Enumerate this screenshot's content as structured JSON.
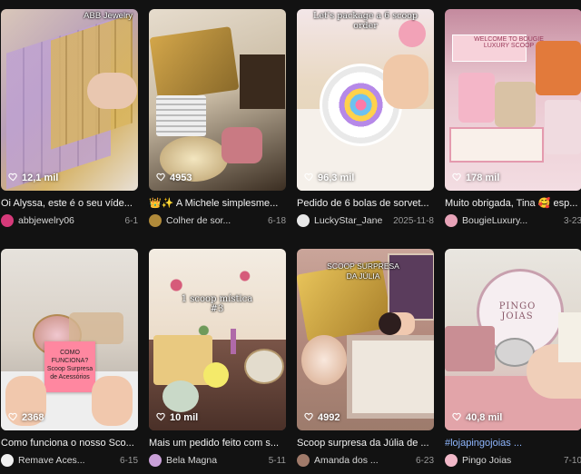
{
  "heart_icon": "heart-outline-icon",
  "cards": [
    {
      "overlay": "ABB Jewelry",
      "views": "12,1 mil",
      "caption": "Oi Alyssa, este é o seu víde...",
      "author": "abbjewelry06",
      "date": "6-1",
      "avatar_color": "#d63a7a"
    },
    {
      "overlay": "",
      "views": "4953",
      "caption": "👑✨ A Michele simplesme...",
      "author": "Colher de sor...",
      "date": "6-18",
      "avatar_color": "#b08a3a"
    },
    {
      "overlay": "Let's package a 6 scoop order",
      "views": "96,3 mil",
      "caption": "Pedido de 6 bolas de sorvet...",
      "author": "LuckyStar_Jane",
      "date": "2025-11-8",
      "avatar_color": "#e8e8e8"
    },
    {
      "overlay": "WELCOME TO BOUGIE LUXURY SCOOP",
      "views": "178 mil",
      "caption": "Muito obrigada, Tina 🥰 esp...",
      "author": "BougieLuxury...",
      "date": "3-23",
      "avatar_color": "#e7a3b8"
    },
    {
      "overlay": "COMO FUNCIONA? Scoop Surpresa de Acessórios",
      "views": "2368",
      "caption": "Como funciona o nosso Sco...",
      "author": "Remave Aces...",
      "date": "6-15",
      "avatar_color": "#f0f0f0"
    },
    {
      "overlay": "1 scoop mística #3",
      "views": "10 mil",
      "caption": "Mais um pedido feito com s...",
      "author": "Bela Magna",
      "date": "5-11",
      "avatar_color": "#c9a0d8"
    },
    {
      "overlay": "SCOOP SURPRESA DA JÚLIA",
      "views": "4992",
      "caption": "Scoop surpresa da Júlia de ...",
      "author": "Amanda dos ...",
      "date": "6-23",
      "avatar_color": "#a07a6a"
    },
    {
      "overlay": "PINGO JOIAS",
      "views": "40,8 mil",
      "caption": "#lojapingojoias ...",
      "author": "Pingo Joias",
      "date": "7-10",
      "avatar_color": "#f1b8c8"
    }
  ]
}
